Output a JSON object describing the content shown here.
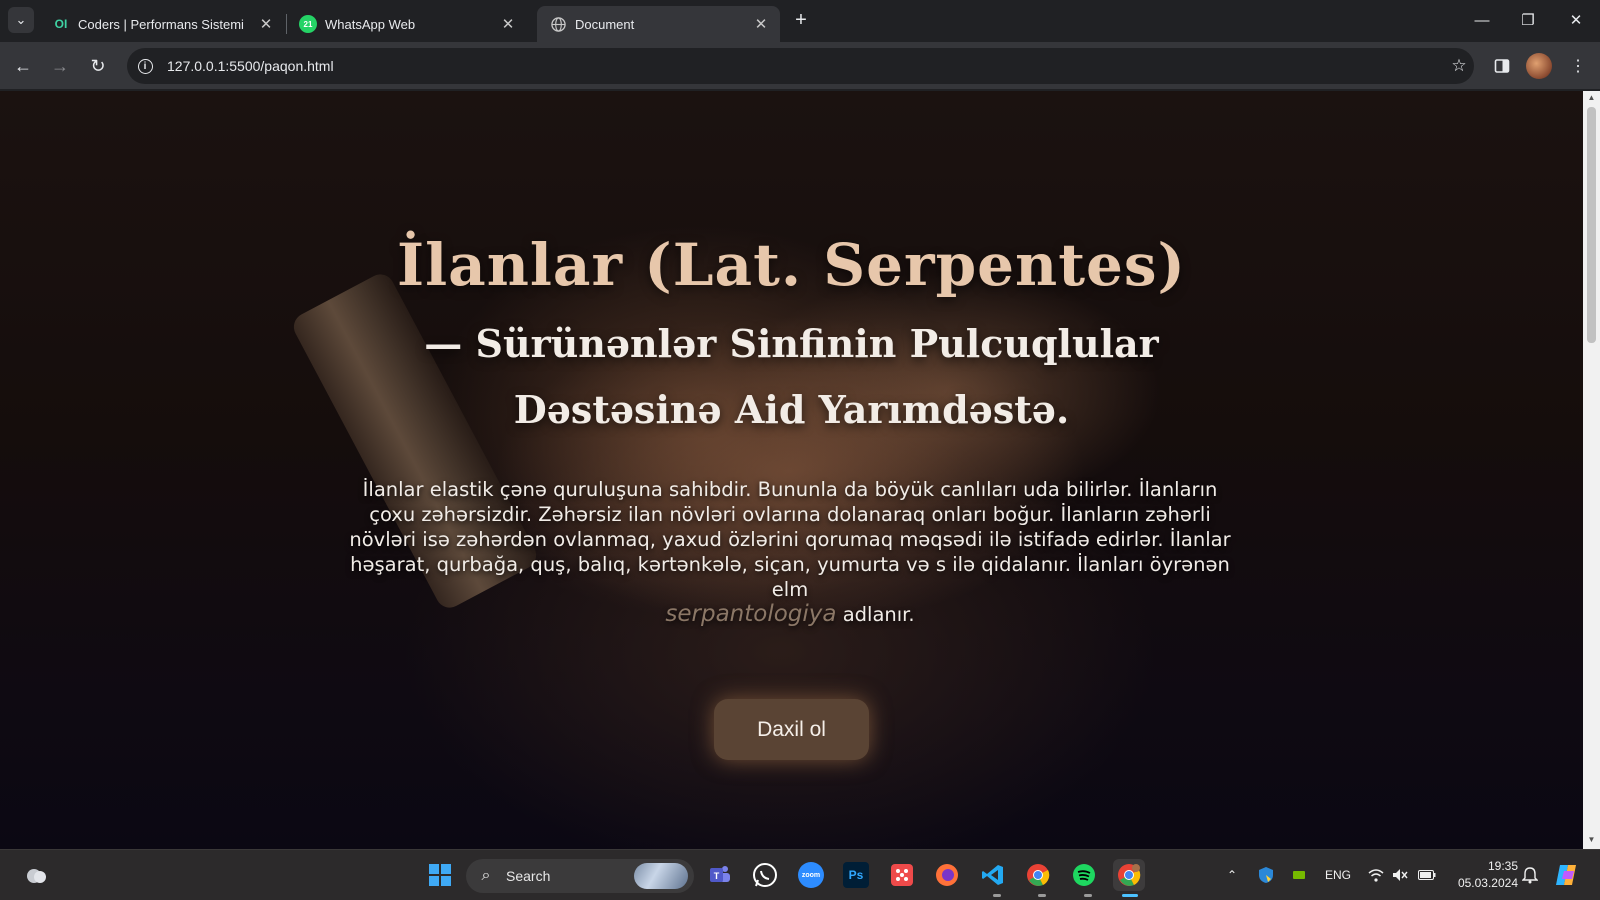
{
  "browser": {
    "tabs": [
      {
        "title": "Coders | Performans Sistemi",
        "favicon": "OI",
        "active": false
      },
      {
        "title": "WhatsApp Web",
        "favicon": "21",
        "active": false
      },
      {
        "title": "Document",
        "favicon": "globe",
        "active": true
      }
    ],
    "new_tab_label": "+",
    "url": "127.0.0.1:5500/paqon.html"
  },
  "page": {
    "title": "İlanlar (Lat. Serpentes)",
    "subtitle_line1": "— Sürünənlər Sinfinin Pulcuqlular",
    "subtitle_line2": "Dəstəsinə Aid Yarımdəstə.",
    "description": "İlanlar elastik çənə quruluşuna sahibdir. Bununla da böyük canlıları uda bilirlər. İlanların çoxu zəhərsizdir. Zəhərsiz ilan növləri ovlarına dolanaraq onları boğur. İlanların zəhərli növləri isə zəhərdən ovlanmaq, yaxud özlərini qorumaq məqsədi ilə istifadə edirlər. İlanlar həşarat, qurbağa, quş, balıq, kərtənkələ, siçan, yumurta və s ilə qidalanır. İlanları öyrənən elm",
    "term": "serpantologiya",
    "description_end": "adlanır.",
    "cta_label": "Daxil ol"
  },
  "taskbar": {
    "search_label": "Search",
    "language": "ENG",
    "time": "19:35",
    "date": "05.03.2024",
    "apps": [
      "start-icon",
      "search-icon",
      "teams-icon",
      "whatsapp-icon",
      "zoom-icon",
      "photoshop-icon",
      "sandbox-icon",
      "firefox-icon",
      "vscode-icon",
      "chrome-icon",
      "spotify-icon",
      "chrome-profile-icon"
    ],
    "app_labels": {
      "zoom": "zoom",
      "photoshop": "Ps"
    }
  },
  "colors": {
    "title": "#e7c7ab",
    "button": "#5a4434",
    "term": "#8b7766"
  }
}
